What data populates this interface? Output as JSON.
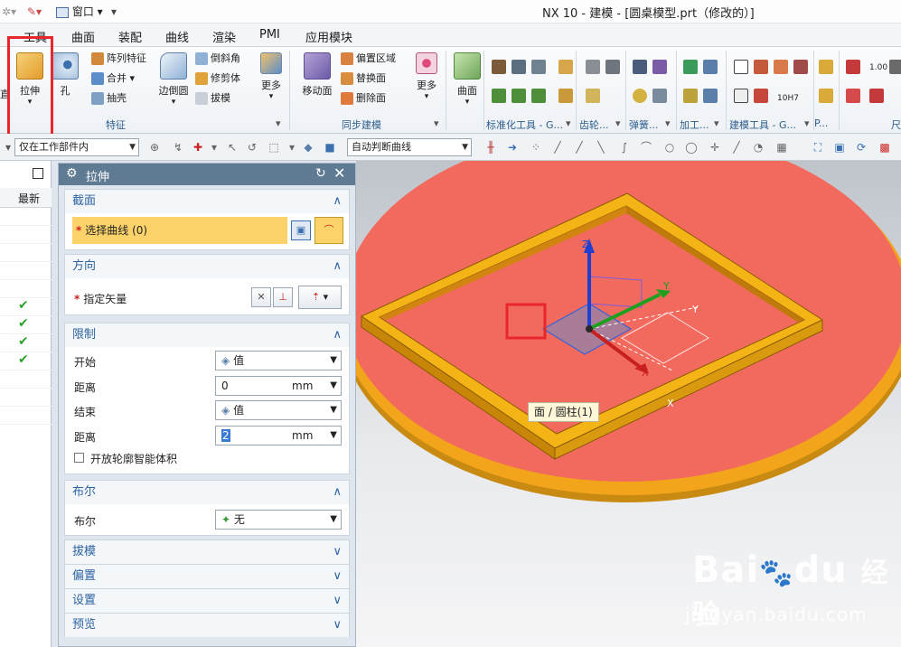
{
  "titlebar": {
    "window_menu": "窗口",
    "title": "NX 10 - 建模 - [圆桌模型.prt（修改的）]"
  },
  "menu_tabs": [
    "工具",
    "曲面",
    "装配",
    "曲线",
    "渲染",
    "PMI",
    "应用模块"
  ],
  "ribbon": {
    "extrude": "拉伸",
    "hole": "孔",
    "pattern_feature": "阵列特征",
    "unite": "合并",
    "shell": "抽壳",
    "edge_blend": "边倒圆",
    "chamfer": "倒斜角",
    "trim_body": "修剪体",
    "draft": "拔模",
    "more1": "更多",
    "move_face": "移动面",
    "offset_region": "偏置区域",
    "replace_face": "替换面",
    "delete_face": "删除面",
    "more2": "更多",
    "surface": "曲面",
    "group_feature": "特征",
    "group_sync": "同步建模",
    "group_std_tools": "标准化工具 - G...",
    "group_gear": "齿轮...",
    "group_spring": "弹簧...",
    "group_machining": "加工...",
    "group_model_tools": "建模工具 - G...",
    "group_p": "P...",
    "group_dim": "尺",
    "dim_value": "1.00",
    "tol_value": "10H7"
  },
  "selbar": {
    "filter": "仅在工作部件内",
    "curve_rule": "自动判断曲线"
  },
  "navigator": {
    "column_latest": "最新"
  },
  "dialog": {
    "title": "拉伸",
    "section_header": "截面",
    "select_curve": "选择曲线 (0)",
    "direction_header": "方向",
    "specify_vector": "指定矢量",
    "limits_header": "限制",
    "start_label": "开始",
    "start_value": "值",
    "distance_label": "距离",
    "start_distance": "0",
    "unit": "mm",
    "end_label": "结束",
    "end_value": "值",
    "end_distance": "2",
    "open_profile": "开放轮廓智能体积",
    "boolean_header": "布尔",
    "boolean_label": "布尔",
    "boolean_value": "无",
    "draft_header": "拔模",
    "offset_header": "偏置",
    "settings_header": "设置",
    "preview_header": "预览"
  },
  "viewport": {
    "tooltip": "面 / 圆柱(1)",
    "axis_z": "Z",
    "axis_y": "Y",
    "axis_x": "X",
    "axis_y2": "Y",
    "axis_x2": "X"
  },
  "watermark": {
    "brand": "Bai",
    "brand2": "du",
    "cn": "经验",
    "url": "jingyan.baidu.com"
  },
  "colors": {
    "table_top": "#f26a5e",
    "table_rim": "#f2a51a",
    "frame": "#f5b416",
    "highlight_red": "#e8262b",
    "accent_blue": "#2d63a0"
  }
}
